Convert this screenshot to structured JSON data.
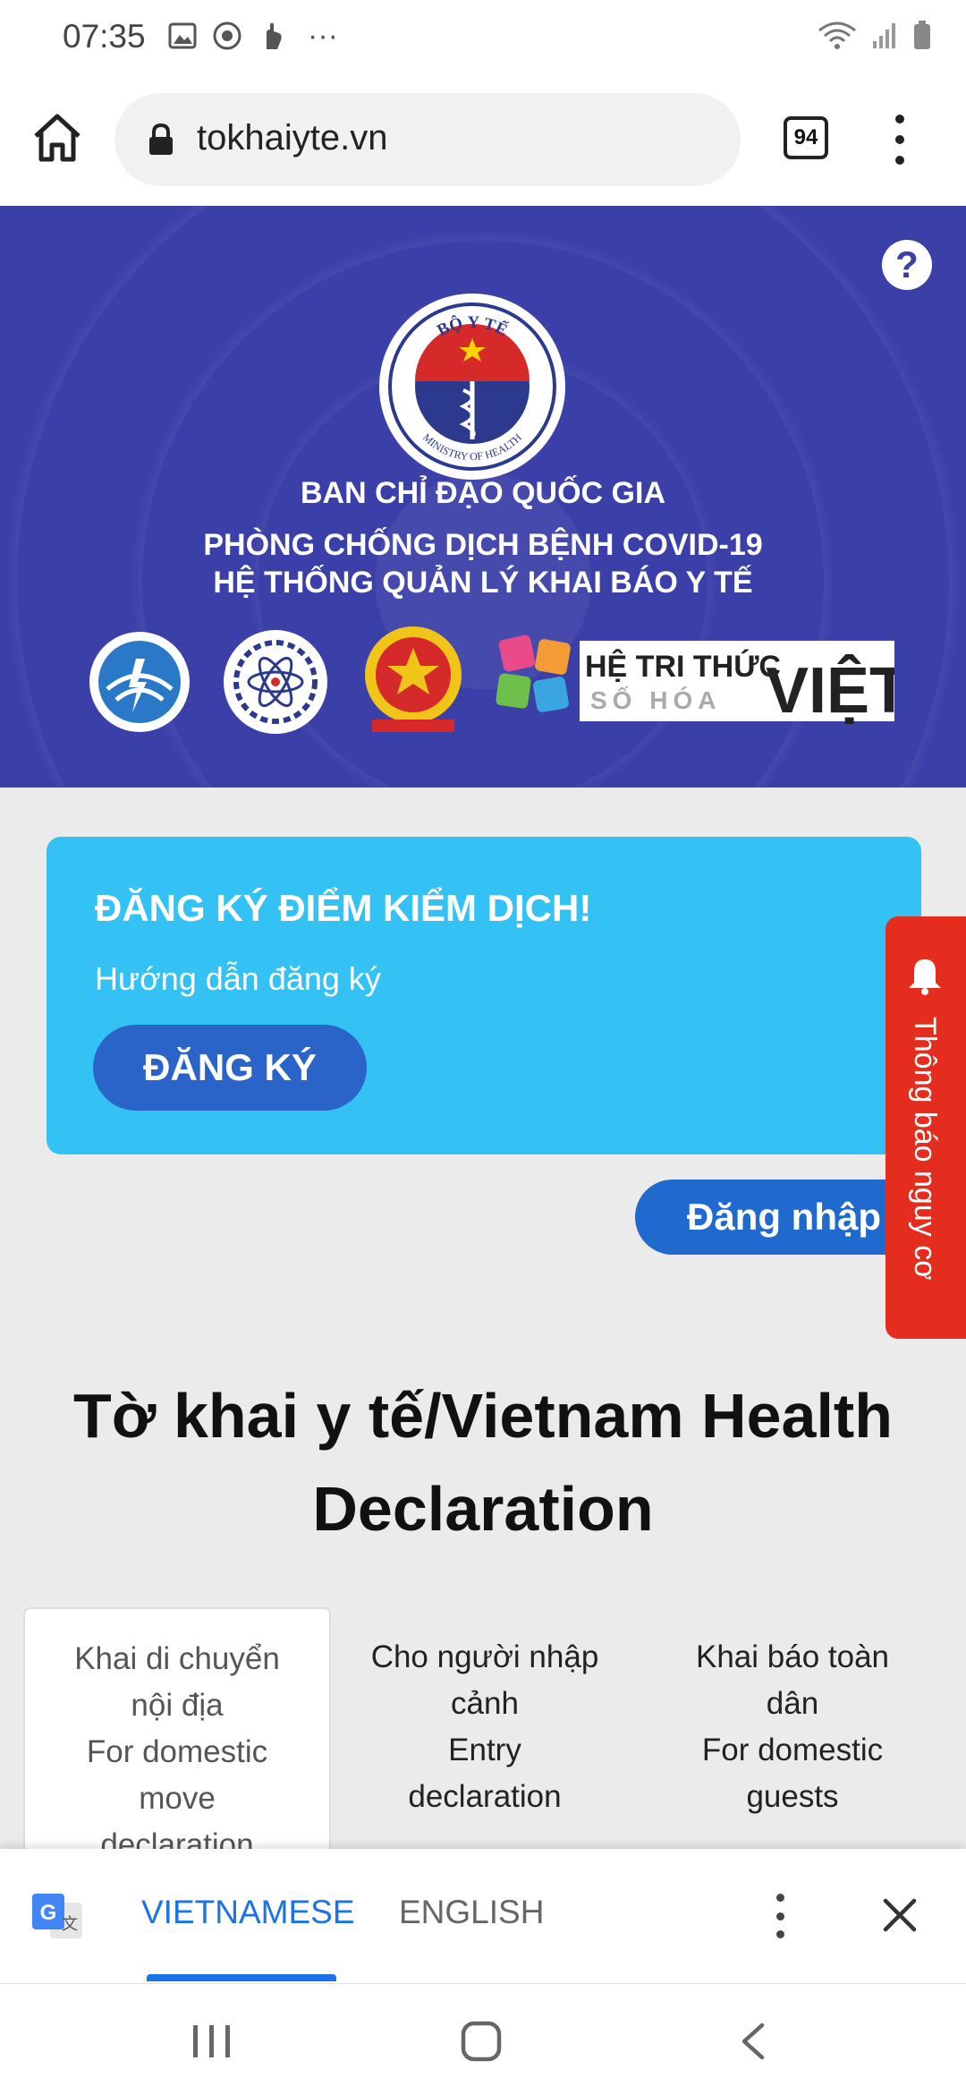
{
  "status_bar": {
    "time": "07:35",
    "left_icons": [
      "image-icon",
      "circle-icon",
      "hand-icon",
      "more-icon"
    ],
    "more_text": "···",
    "right_icons": [
      "wifi-icon",
      "signal-icon",
      "battery-icon"
    ]
  },
  "browser": {
    "url": "tokhaiyte.vn",
    "tab_count": "94"
  },
  "banner": {
    "logo_text_top": "BỘ Y TẾ",
    "logo_text_bottom": "MINISTRY OF HEALTH",
    "line1": "BAN CHỈ ĐẠO QUỐC GIA",
    "line2": "PHÒNG CHỐNG DỊCH BỆNH COVID-19",
    "line3": "HỆ THỐNG QUẢN LÝ KHAI BÁO Y TẾ",
    "help_icon": "?",
    "partner_brand_line1": "HỆ TRI THỨC",
    "partner_brand_line2": "SỐ HÓA",
    "partner_brand_big": "VIỆT"
  },
  "register_card": {
    "title": "ĐĂNG KÝ ĐIỂM KIỂM DỊCH!",
    "subtitle": "Hướng dẫn đăng ký",
    "button": "ĐĂNG KÝ"
  },
  "login_button": "Đăng nhập",
  "risk_tab": "Thông báo nguy cơ",
  "heading": "Tờ khai y tế/Vietnam Health Declaration",
  "declaration_tabs": [
    {
      "lines": [
        "Khai di chuyển",
        "nội địa",
        "For domestic",
        "move",
        "declaration"
      ]
    },
    {
      "lines": [
        "Cho người nhập",
        "cảnh",
        "Entry",
        "declaration"
      ]
    },
    {
      "lines": [
        "Khai báo toàn",
        "dân",
        "For domestic",
        "guests"
      ]
    }
  ],
  "translate_bar": {
    "lang_selected": "VIETNAMESE",
    "lang_other": "ENGLISH"
  },
  "colors": {
    "banner": "#3b3fa8",
    "card": "#33c2f3",
    "button": "#2a64c8",
    "risk": "#e52d1f",
    "link": "#1a73e8"
  }
}
